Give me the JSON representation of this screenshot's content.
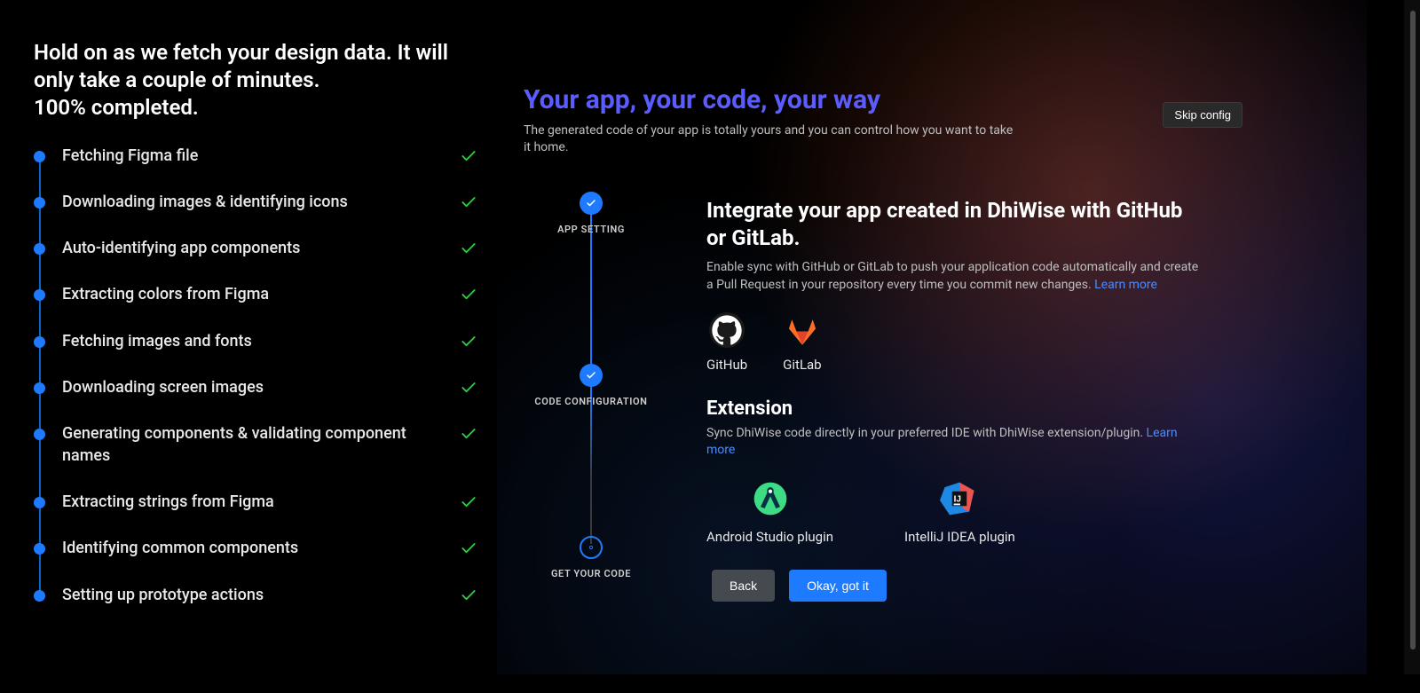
{
  "left": {
    "headline_line1": "Hold on as we fetch your design data. It will only take a couple of minutes.",
    "headline_line2": "100% completed.",
    "steps": [
      "Fetching Figma file",
      "Downloading images & identifying icons",
      "Auto-identifying app components",
      "Extracting colors from Figma",
      "Fetching images and fonts",
      "Downloading screen images",
      "Generating components & validating component names",
      "Extracting strings from Figma",
      "Identifying common components",
      "Setting up prototype actions"
    ]
  },
  "right": {
    "wizard_title": "Your app, your code, your way",
    "wizard_subtitle": "The generated code of your app is totally yours and you can control how you want to take it home.",
    "skip": "Skip config",
    "stepper": {
      "s1": "APP SETTING",
      "s2": "CODE CONFIGURATION",
      "s3": "GET YOUR CODE"
    },
    "integrate": {
      "heading": "Integrate your app created in DhiWise with GitHub or GitLab.",
      "desc": "Enable sync with GitHub or GitLab to push your application code automatically and create a Pull Request in your repository every time you commit new changes.",
      "learn": "Learn more",
      "github": "GitHub",
      "gitlab": "GitLab"
    },
    "extension": {
      "heading": "Extension",
      "desc": "Sync DhiWise code directly in your preferred IDE with DhiWise extension/plugin.",
      "learn": "Learn more",
      "android": "Android Studio plugin",
      "intellij": "IntelliJ IDEA plugin"
    },
    "buttons": {
      "back": "Back",
      "ok": "Okay, got it"
    }
  }
}
